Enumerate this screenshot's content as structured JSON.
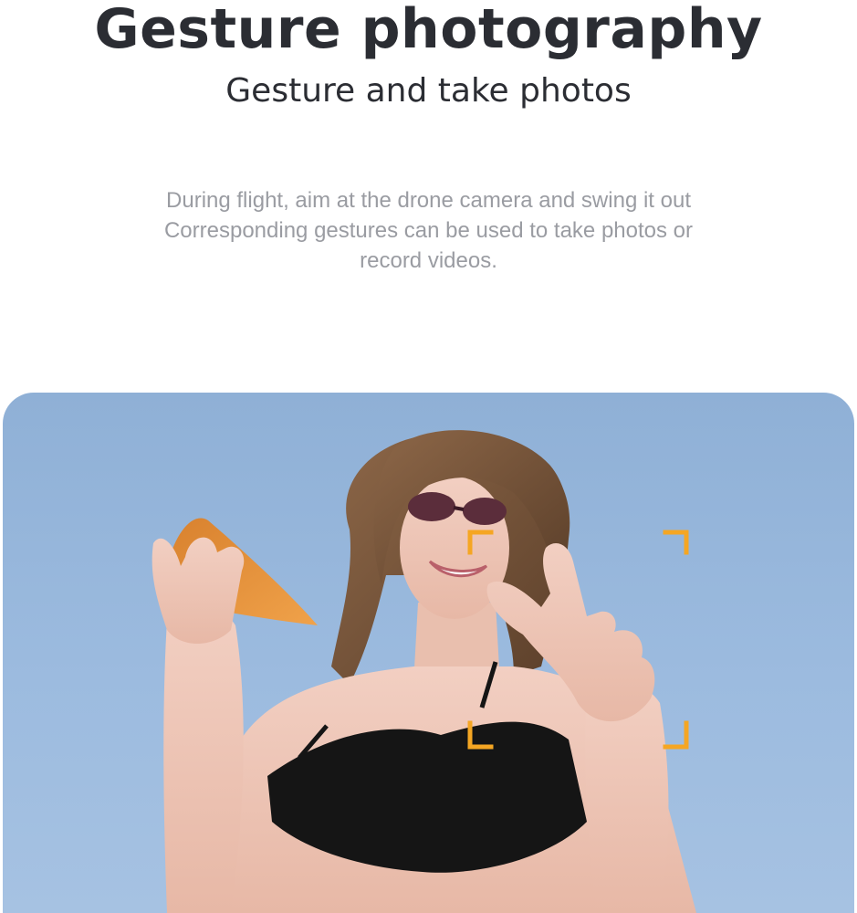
{
  "header": {
    "title": "Gesture photography",
    "subtitle": "Gesture and take photos"
  },
  "content": {
    "description": "During flight, aim at the drone camera and swing it out Corresponding gestures can be used to take photos or record videos."
  },
  "photo": {
    "subject": "woman with sunglasses holding pizza slice and making peace sign",
    "focus_frame_color": "#f5a623"
  },
  "colors": {
    "title": "#2b2d33",
    "description": "#9a9ca2",
    "sky": "#9cbbdf",
    "accent": "#f5a623"
  }
}
